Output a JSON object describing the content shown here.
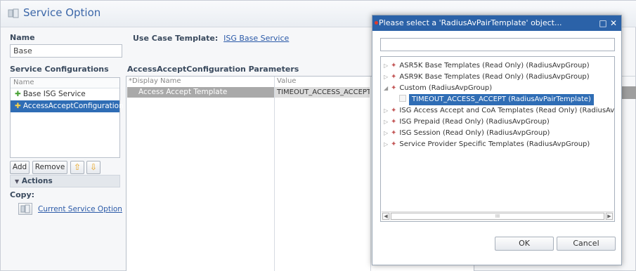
{
  "page": {
    "title": "Service Option"
  },
  "name_section": {
    "label": "Name",
    "value": "Base"
  },
  "use_case": {
    "label": "Use Case Template:",
    "link": "ISG Base Service"
  },
  "service_configurations": {
    "label": "Service Configurations",
    "column_header": "Name",
    "items": [
      {
        "label": "Base ISG Service",
        "icon": "plus-green"
      },
      {
        "label": "AccessAcceptConfiguration",
        "icon": "plus-yellow",
        "selected": true
      }
    ],
    "buttons": {
      "add": "Add",
      "remove": "Remove"
    }
  },
  "actions": {
    "header": "Actions",
    "copy_label": "Copy:",
    "copy_link": "Current Service Option"
  },
  "parameters": {
    "title": "AccessAcceptConfiguration Parameters",
    "columns": [
      "*Display Name",
      "Value"
    ],
    "rows": [
      {
        "display_name": "Access Accept Template",
        "value": "TIMEOUT_ACCESS_ACCEPT"
      }
    ]
  },
  "dialog": {
    "title": "Please select a 'RadiusAvPairTemplate' object...",
    "controls": "□ ✕",
    "search_value": "",
    "tree": [
      {
        "label": "ASR5K Base Templates (Read Only) (RadiusAvpGroup)",
        "expanded": false
      },
      {
        "label": "ASR9K Base Templates (Read Only) (RadiusAvpGroup)",
        "expanded": false
      },
      {
        "label": "Custom (RadiusAvpGroup)",
        "expanded": true,
        "children": [
          {
            "label": "TIMEOUT_ACCESS_ACCEPT (RadiusAvPairTemplate)",
            "selected": true
          }
        ]
      },
      {
        "label": "ISG Access Accept and CoA Templates (Read Only) (RadiusAvpG",
        "expanded": false
      },
      {
        "label": "ISG Prepaid (Read Only) (RadiusAvpGroup)",
        "expanded": false
      },
      {
        "label": "ISG Session (Read Only) (RadiusAvpGroup)",
        "expanded": false
      },
      {
        "label": "Service Provider Specific Templates (RadiusAvpGroup)",
        "expanded": false
      }
    ],
    "buttons": {
      "ok": "OK",
      "cancel": "Cancel"
    }
  },
  "colors": {
    "accent": "#2b62a8",
    "selection": "#2f6db5",
    "title_text": "#3b66a8"
  }
}
